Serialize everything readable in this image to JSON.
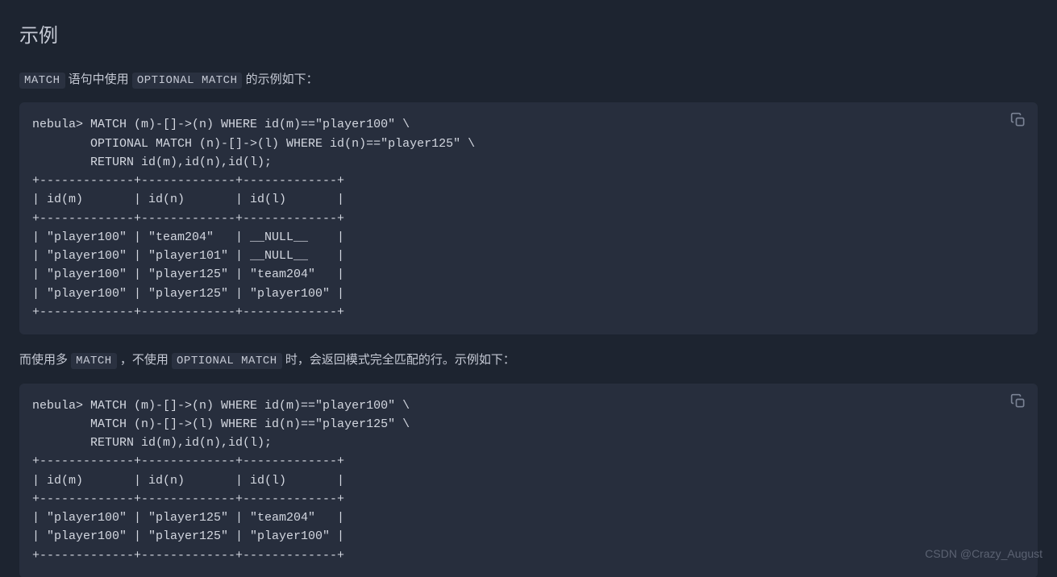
{
  "title": "示例",
  "desc1": {
    "prefix": "",
    "code1": "MATCH",
    "mid1": " 语句中使用 ",
    "code2": "OPTIONAL MATCH",
    "suffix": " 的示例如下："
  },
  "code1": "nebula> MATCH (m)-[]->(n) WHERE id(m)==\"player100\" \\\n        OPTIONAL MATCH (n)-[]->(l) WHERE id(n)==\"player125\" \\\n        RETURN id(m),id(n),id(l);\n+-------------+-------------+-------------+\n| id(m)       | id(n)       | id(l)       |\n+-------------+-------------+-------------+\n| \"player100\" | \"team204\"   | __NULL__    |\n| \"player100\" | \"player101\" | __NULL__    |\n| \"player100\" | \"player125\" | \"team204\"   |\n| \"player100\" | \"player125\" | \"player100\" |\n+-------------+-------------+-------------+",
  "desc2": {
    "prefix": "而使用多 ",
    "code1": "MATCH",
    "mid1": " ，不使用 ",
    "code2": "OPTIONAL MATCH",
    "suffix": " 时，会返回模式完全匹配的行。示例如下："
  },
  "code2": "nebula> MATCH (m)-[]->(n) WHERE id(m)==\"player100\" \\\n        MATCH (n)-[]->(l) WHERE id(n)==\"player125\" \\\n        RETURN id(m),id(n),id(l);\n+-------------+-------------+-------------+\n| id(m)       | id(n)       | id(l)       |\n+-------------+-------------+-------------+\n| \"player100\" | \"player125\" | \"team204\"   |\n| \"player100\" | \"player125\" | \"player100\" |\n+-------------+-------------+-------------+",
  "watermark": "CSDN @Crazy_August"
}
